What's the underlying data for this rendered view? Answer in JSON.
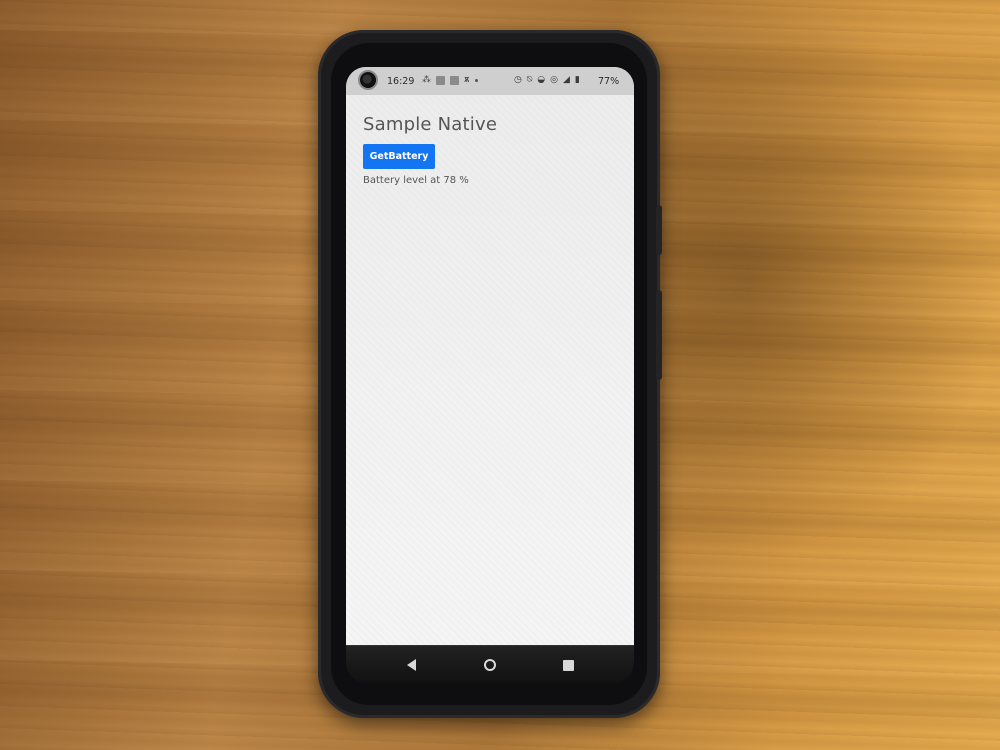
{
  "status_bar": {
    "time": "16:29",
    "battery_percent": "77%",
    "left_icons": [
      "wifi-calling-icon",
      "notification-icon",
      "notification-icon",
      "cat-icon",
      "dot-icon"
    ],
    "right_icons": [
      "alarm-icon",
      "mute-icon",
      "wifi-icon",
      "hotspot-icon",
      "signal-icon",
      "battery-icon"
    ]
  },
  "app": {
    "title": "Sample Native",
    "button_label": "GetBattery",
    "battery_text": "Battery level at 78 %",
    "accent_color": "#1375f2"
  },
  "nav": {
    "back_icon": "back-icon",
    "home_icon": "home-icon",
    "recents_icon": "recents-icon"
  }
}
